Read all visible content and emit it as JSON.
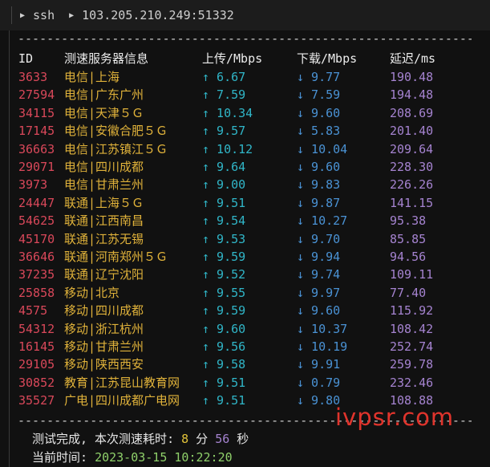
{
  "titlebar": {
    "segments": [
      "ssh",
      "103.205.210.249:51332"
    ]
  },
  "divider": "------------------------------------------------------------------------",
  "table": {
    "headers": {
      "id": "ID",
      "server": "测速服务器信息",
      "upload": "上传/Mbps",
      "download": "下载/Mbps",
      "latency": "延迟/ms"
    },
    "rows": [
      {
        "id": "3633",
        "server": "电信|上海",
        "up": "↑ 6.67",
        "down": "↓ 9.77",
        "lat": "190.48"
      },
      {
        "id": "27594",
        "server": "电信|广东广州",
        "up": "↑ 7.59",
        "down": "↓ 7.59",
        "lat": "194.48"
      },
      {
        "id": "34115",
        "server": "电信|天津５Ｇ",
        "up": "↑ 10.34",
        "down": "↓ 9.60",
        "lat": "208.69"
      },
      {
        "id": "17145",
        "server": "电信|安徽合肥５Ｇ",
        "up": "↑ 9.57",
        "down": "↓ 5.83",
        "lat": "201.40"
      },
      {
        "id": "36663",
        "server": "电信|江苏镇江５Ｇ",
        "up": "↑ 10.12",
        "down": "↓ 10.04",
        "lat": "209.64"
      },
      {
        "id": "29071",
        "server": "电信|四川成都",
        "up": "↑ 9.64",
        "down": "↓ 9.60",
        "lat": "228.30"
      },
      {
        "id": "3973",
        "server": "电信|甘肃兰州",
        "up": "↑ 9.00",
        "down": "↓ 9.83",
        "lat": "226.26"
      },
      {
        "id": "24447",
        "server": "联通|上海５Ｇ",
        "up": "↑ 9.51",
        "down": "↓ 9.87",
        "lat": "141.15"
      },
      {
        "id": "54625",
        "server": "联通|江西南昌",
        "up": "↑ 9.54",
        "down": "↓ 10.27",
        "lat": "95.38"
      },
      {
        "id": "45170",
        "server": "联通|江苏无锡",
        "up": "↑ 9.53",
        "down": "↓ 9.70",
        "lat": "85.85"
      },
      {
        "id": "36646",
        "server": "联通|河南郑州５Ｇ",
        "up": "↑ 9.59",
        "down": "↓ 9.94",
        "lat": "94.56"
      },
      {
        "id": "37235",
        "server": "联通|辽宁沈阳",
        "up": "↑ 9.52",
        "down": "↓ 9.74",
        "lat": "109.11"
      },
      {
        "id": "25858",
        "server": "移动|北京",
        "up": "↑ 9.55",
        "down": "↓ 9.97",
        "lat": "77.40"
      },
      {
        "id": "4575",
        "server": "移动|四川成都",
        "up": "↑ 9.59",
        "down": "↓ 9.60",
        "lat": "115.92"
      },
      {
        "id": "54312",
        "server": "移动|浙江杭州",
        "up": "↑ 9.60",
        "down": "↓ 10.37",
        "lat": "108.42"
      },
      {
        "id": "16145",
        "server": "移动|甘肃兰州",
        "up": "↑ 9.56",
        "down": "↓ 10.19",
        "lat": "252.74"
      },
      {
        "id": "29105",
        "server": "移动|陕西西安",
        "up": "↑ 9.58",
        "down": "↓ 9.91",
        "lat": "259.78"
      },
      {
        "id": "30852",
        "server": "教育|江苏昆山教育网",
        "up": "↑ 9.51",
        "down": "↓ 0.79",
        "lat": "232.46"
      },
      {
        "id": "35527",
        "server": "广电|四川成都广电网",
        "up": "↑ 9.51",
        "down": "↓ 9.80",
        "lat": "108.88"
      }
    ]
  },
  "footer": {
    "done_prefix": "测试完成, 本次测速耗时: ",
    "minutes": "8",
    "min_unit": " 分 ",
    "seconds": "56",
    "sec_unit": " 秒",
    "time_prefix": "当前时间: ",
    "time_value": "2023-03-15 10:22:20"
  },
  "watermark": "ivpsr.com",
  "colors": {
    "id": "#d9485a",
    "server": "#e0b23a",
    "upload": "#30b6c8",
    "download": "#4a92d4",
    "latency": "#a583d0",
    "watermark": "#e0342c"
  }
}
